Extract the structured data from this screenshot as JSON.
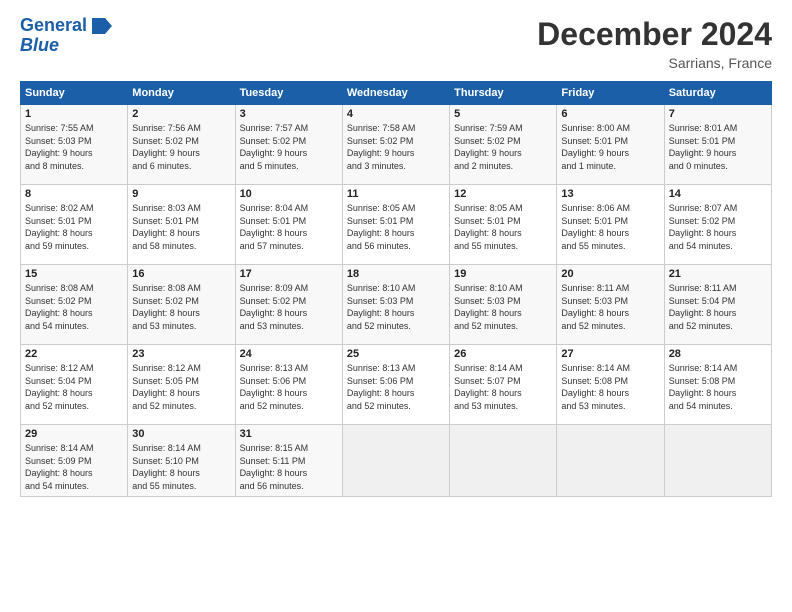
{
  "header": {
    "logo_line1": "General",
    "logo_line2": "Blue",
    "month": "December 2024",
    "location": "Sarrians, France"
  },
  "weekdays": [
    "Sunday",
    "Monday",
    "Tuesday",
    "Wednesday",
    "Thursday",
    "Friday",
    "Saturday"
  ],
  "weeks": [
    [
      {
        "day": "1",
        "info": "Sunrise: 7:55 AM\nSunset: 5:03 PM\nDaylight: 9 hours\nand 8 minutes."
      },
      {
        "day": "2",
        "info": "Sunrise: 7:56 AM\nSunset: 5:02 PM\nDaylight: 9 hours\nand 6 minutes."
      },
      {
        "day": "3",
        "info": "Sunrise: 7:57 AM\nSunset: 5:02 PM\nDaylight: 9 hours\nand 5 minutes."
      },
      {
        "day": "4",
        "info": "Sunrise: 7:58 AM\nSunset: 5:02 PM\nDaylight: 9 hours\nand 3 minutes."
      },
      {
        "day": "5",
        "info": "Sunrise: 7:59 AM\nSunset: 5:02 PM\nDaylight: 9 hours\nand 2 minutes."
      },
      {
        "day": "6",
        "info": "Sunrise: 8:00 AM\nSunset: 5:01 PM\nDaylight: 9 hours\nand 1 minute."
      },
      {
        "day": "7",
        "info": "Sunrise: 8:01 AM\nSunset: 5:01 PM\nDaylight: 9 hours\nand 0 minutes."
      }
    ],
    [
      {
        "day": "8",
        "info": "Sunrise: 8:02 AM\nSunset: 5:01 PM\nDaylight: 8 hours\nand 59 minutes."
      },
      {
        "day": "9",
        "info": "Sunrise: 8:03 AM\nSunset: 5:01 PM\nDaylight: 8 hours\nand 58 minutes."
      },
      {
        "day": "10",
        "info": "Sunrise: 8:04 AM\nSunset: 5:01 PM\nDaylight: 8 hours\nand 57 minutes."
      },
      {
        "day": "11",
        "info": "Sunrise: 8:05 AM\nSunset: 5:01 PM\nDaylight: 8 hours\nand 56 minutes."
      },
      {
        "day": "12",
        "info": "Sunrise: 8:05 AM\nSunset: 5:01 PM\nDaylight: 8 hours\nand 55 minutes."
      },
      {
        "day": "13",
        "info": "Sunrise: 8:06 AM\nSunset: 5:01 PM\nDaylight: 8 hours\nand 55 minutes."
      },
      {
        "day": "14",
        "info": "Sunrise: 8:07 AM\nSunset: 5:02 PM\nDaylight: 8 hours\nand 54 minutes."
      }
    ],
    [
      {
        "day": "15",
        "info": "Sunrise: 8:08 AM\nSunset: 5:02 PM\nDaylight: 8 hours\nand 54 minutes."
      },
      {
        "day": "16",
        "info": "Sunrise: 8:08 AM\nSunset: 5:02 PM\nDaylight: 8 hours\nand 53 minutes."
      },
      {
        "day": "17",
        "info": "Sunrise: 8:09 AM\nSunset: 5:02 PM\nDaylight: 8 hours\nand 53 minutes."
      },
      {
        "day": "18",
        "info": "Sunrise: 8:10 AM\nSunset: 5:03 PM\nDaylight: 8 hours\nand 52 minutes."
      },
      {
        "day": "19",
        "info": "Sunrise: 8:10 AM\nSunset: 5:03 PM\nDaylight: 8 hours\nand 52 minutes."
      },
      {
        "day": "20",
        "info": "Sunrise: 8:11 AM\nSunset: 5:03 PM\nDaylight: 8 hours\nand 52 minutes."
      },
      {
        "day": "21",
        "info": "Sunrise: 8:11 AM\nSunset: 5:04 PM\nDaylight: 8 hours\nand 52 minutes."
      }
    ],
    [
      {
        "day": "22",
        "info": "Sunrise: 8:12 AM\nSunset: 5:04 PM\nDaylight: 8 hours\nand 52 minutes."
      },
      {
        "day": "23",
        "info": "Sunrise: 8:12 AM\nSunset: 5:05 PM\nDaylight: 8 hours\nand 52 minutes."
      },
      {
        "day": "24",
        "info": "Sunrise: 8:13 AM\nSunset: 5:06 PM\nDaylight: 8 hours\nand 52 minutes."
      },
      {
        "day": "25",
        "info": "Sunrise: 8:13 AM\nSunset: 5:06 PM\nDaylight: 8 hours\nand 52 minutes."
      },
      {
        "day": "26",
        "info": "Sunrise: 8:14 AM\nSunset: 5:07 PM\nDaylight: 8 hours\nand 53 minutes."
      },
      {
        "day": "27",
        "info": "Sunrise: 8:14 AM\nSunset: 5:08 PM\nDaylight: 8 hours\nand 53 minutes."
      },
      {
        "day": "28",
        "info": "Sunrise: 8:14 AM\nSunset: 5:08 PM\nDaylight: 8 hours\nand 54 minutes."
      }
    ],
    [
      {
        "day": "29",
        "info": "Sunrise: 8:14 AM\nSunset: 5:09 PM\nDaylight: 8 hours\nand 54 minutes."
      },
      {
        "day": "30",
        "info": "Sunrise: 8:14 AM\nSunset: 5:10 PM\nDaylight: 8 hours\nand 55 minutes."
      },
      {
        "day": "31",
        "info": "Sunrise: 8:15 AM\nSunset: 5:11 PM\nDaylight: 8 hours\nand 56 minutes."
      },
      {
        "day": "",
        "info": ""
      },
      {
        "day": "",
        "info": ""
      },
      {
        "day": "",
        "info": ""
      },
      {
        "day": "",
        "info": ""
      }
    ]
  ]
}
